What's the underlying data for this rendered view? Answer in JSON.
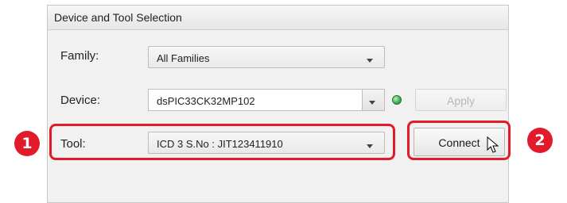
{
  "panel": {
    "title": "Device and Tool Selection"
  },
  "family": {
    "label": "Family:",
    "value": "All Families"
  },
  "device": {
    "label": "Device:",
    "value": "dsPIC33CK32MP102",
    "status": "connected",
    "status_color": "#3fb34f"
  },
  "apply_button": {
    "label": "Apply",
    "enabled": false
  },
  "tool": {
    "label": "Tool:",
    "value": "ICD 3 S.No : JIT123411910"
  },
  "connect_button": {
    "label": "Connect"
  },
  "callouts": [
    {
      "number": "1"
    },
    {
      "number": "2"
    }
  ],
  "colors": {
    "callout": "#e21b2b",
    "panel_bg": "#f1f1f1"
  }
}
